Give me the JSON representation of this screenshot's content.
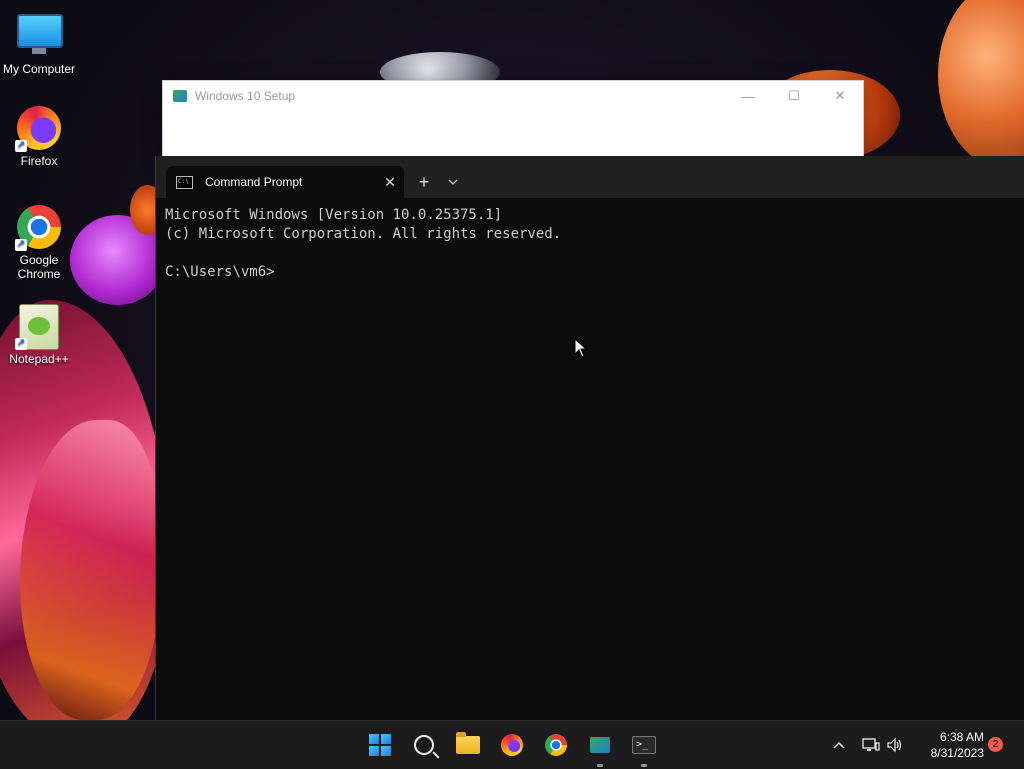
{
  "desktop": {
    "icons": [
      {
        "label": "My Computer",
        "icon": "computer-icon"
      },
      {
        "label": "Firefox",
        "icon": "firefox-icon"
      },
      {
        "label": "Google Chrome",
        "icon": "chrome-icon"
      },
      {
        "label": "Notepad++",
        "icon": "notepadpp-icon"
      }
    ]
  },
  "setup_window": {
    "title": "Windows 10 Setup",
    "minimize": "—",
    "maximize": "☐",
    "close": "✕"
  },
  "terminal": {
    "tab_title": "Command Prompt",
    "tab_close": "✕",
    "new_tab": "+",
    "dropdown": "⌵",
    "tab_icon_text": "C:\\",
    "lines": [
      "Microsoft Windows [Version 10.0.25375.1]",
      "(c) Microsoft Corporation. All rights reserved.",
      "",
      "C:\\Users\\vm6>"
    ]
  },
  "taskbar": {
    "apps": [
      "start",
      "search",
      "file-explorer",
      "firefox",
      "chrome",
      "windows-10-setup",
      "terminal"
    ],
    "tray": {
      "chevron": "^",
      "network": "🖧",
      "volume": "🔊"
    },
    "clock": {
      "time": "6:38 AM",
      "date": "8/31/2023"
    },
    "notification_count": "2"
  },
  "colors": {
    "terminal_bg": "#0c0c0c",
    "terminal_text": "#cccccc",
    "tabbar_bg": "#202020",
    "taskbar_bg": "#1c1c1c",
    "notification_badge": "#f25a4a"
  }
}
